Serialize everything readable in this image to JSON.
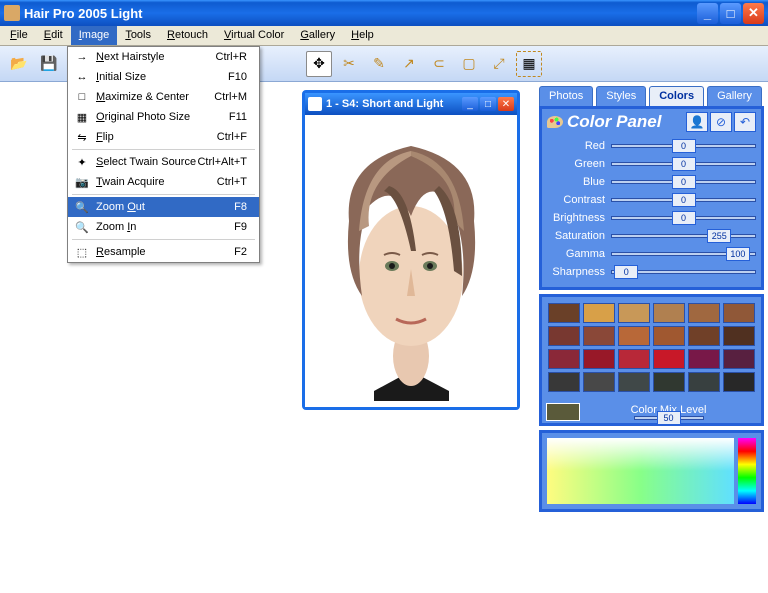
{
  "app": {
    "title": "Hair Pro 2005 Light"
  },
  "menubar": [
    "File",
    "Edit",
    "Image",
    "Tools",
    "Retouch",
    "Virtual Color",
    "Gallery",
    "Help"
  ],
  "menubar_open_index": 2,
  "image_menu": [
    {
      "icon": "→",
      "label": "Next Hairstyle",
      "shortcut": "Ctrl+R",
      "u": 0
    },
    {
      "icon": "↔",
      "label": "Initial Size",
      "shortcut": "F10",
      "u": 0
    },
    {
      "icon": "□",
      "label": "Maximize & Center",
      "shortcut": "Ctrl+M",
      "u": 0
    },
    {
      "icon": "▦",
      "label": "Original Photo Size",
      "shortcut": "F11",
      "u": 0
    },
    {
      "icon": "⇋",
      "label": "Flip",
      "shortcut": "Ctrl+F",
      "u": 0
    },
    {
      "sep": true
    },
    {
      "icon": "✦",
      "label": "Select Twain Source",
      "shortcut": "Ctrl+Alt+T",
      "u": 0
    },
    {
      "icon": "📷",
      "label": "Twain Acquire",
      "shortcut": "Ctrl+T",
      "u": 0
    },
    {
      "sep": true
    },
    {
      "icon": "🔍",
      "label": "Zoom Out",
      "shortcut": "F8",
      "hover": true,
      "u": 5
    },
    {
      "icon": "🔍",
      "label": "Zoom In",
      "shortcut": "F9",
      "u": 5
    },
    {
      "sep": true
    },
    {
      "icon": "⬚",
      "label": "Resample",
      "shortcut": "F2",
      "u": 0
    }
  ],
  "child_window": {
    "title": "1 - S4: Short and Light"
  },
  "side": {
    "tabs": [
      "Photos",
      "Styles",
      "Colors",
      "Gallery"
    ],
    "active_tab": 2,
    "panel_title": "Color Panel",
    "sliders": [
      {
        "label": "Red",
        "val": 0,
        "pos": 50
      },
      {
        "label": "Green",
        "val": 0,
        "pos": 50
      },
      {
        "label": "Blue",
        "val": 0,
        "pos": 50
      },
      {
        "label": "Contrast",
        "val": 0,
        "pos": 50
      },
      {
        "label": "Brightness",
        "val": 0,
        "pos": 50
      },
      {
        "label": "Saturation",
        "val": 255,
        "pos": 75
      },
      {
        "label": "Gamma",
        "val": 100,
        "pos": 88
      },
      {
        "label": "Sharpness",
        "val": 0,
        "pos": 10
      }
    ],
    "swatches": [
      [
        "#6a4028",
        "#d8a048",
        "#c89858",
        "#b08050",
        "#a06840",
        "#905838"
      ],
      [
        "#783830",
        "#8a4838",
        "#b86838",
        "#a05830",
        "#704028",
        "#503020"
      ],
      [
        "#8a2838",
        "#981828",
        "#b82838",
        "#c81828",
        "#781848",
        "#582040"
      ],
      [
        "#383838",
        "#484848",
        "#404848",
        "#303830",
        "#384040",
        "#282828"
      ]
    ],
    "mix_label": "Color Mix Level",
    "mix_value": 50
  }
}
